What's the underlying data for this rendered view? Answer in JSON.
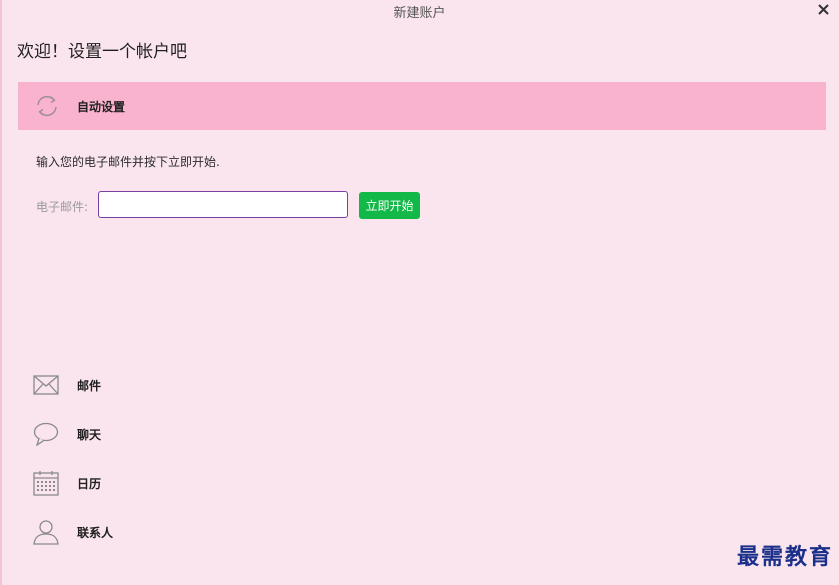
{
  "window": {
    "title": "新建账户",
    "close_icon": "close-icon"
  },
  "heading": "欢迎！设置一个帐户吧",
  "auto_setup": {
    "icon": "sync-icon",
    "label": "自动设置",
    "banner_color": "#f9b3ce"
  },
  "form": {
    "instruction": "输入您的电子邮件并按下立即开始.",
    "email_label": "电子邮件:",
    "email_value": "",
    "email_placeholder": "",
    "start_button": "立即开始",
    "start_button_color": "#12b848"
  },
  "features": [
    {
      "icon": "mail-icon",
      "label": "邮件"
    },
    {
      "icon": "chat-icon",
      "label": "聊天"
    },
    {
      "icon": "calendar-icon",
      "label": "日历"
    },
    {
      "icon": "contacts-icon",
      "label": "联系人"
    }
  ],
  "watermark": "最需教育",
  "colors": {
    "background": "#fae5ee",
    "input_border": "#7b3fa3",
    "watermark": "#1a2f8a"
  }
}
